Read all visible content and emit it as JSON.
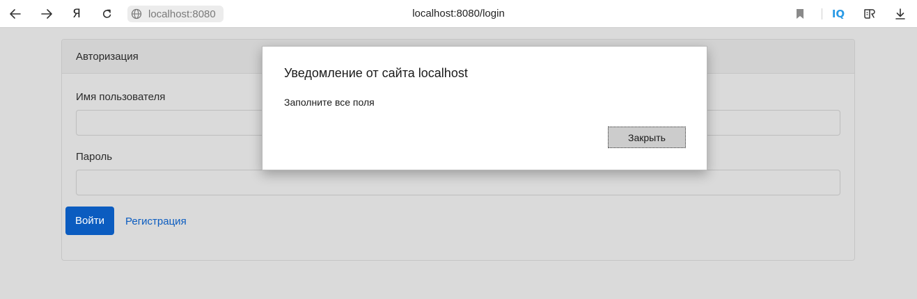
{
  "browser": {
    "back_icon": "arrow-left-icon",
    "forward_icon": "arrow-right-icon",
    "yandex_glyph": "Я",
    "reload_icon": "reload-icon",
    "origin_label": "localhost:8080",
    "address": "localhost:8080/login",
    "bookmark_icon": "bookmark-icon",
    "iq_label": "IQ",
    "reader_icon": "reader-icon",
    "download_icon": "download-icon"
  },
  "login_card": {
    "header": "Авторизация",
    "username_label": "Имя пользователя",
    "username_value": "",
    "password_label": "Пароль",
    "password_value": "",
    "login_button": "Войти",
    "register_link": "Регистрация"
  },
  "alert": {
    "title": "Уведомление от сайта localhost",
    "message": "Заполните все поля",
    "close_button": "Закрыть"
  },
  "colors": {
    "primary": "#0b5cc0",
    "overlay_background": "#dadada",
    "iq_accent": "#2a9ae5"
  }
}
